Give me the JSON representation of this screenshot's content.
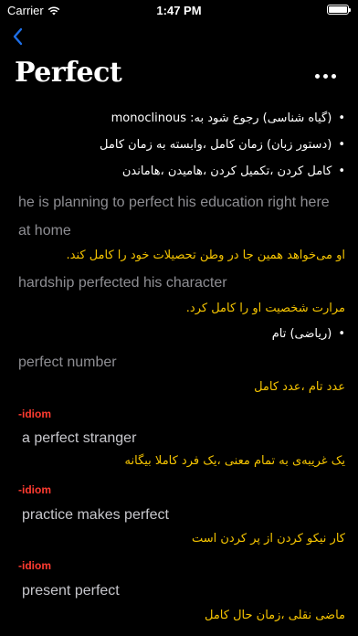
{
  "status_bar": {
    "carrier": "Carrier",
    "time": "1:47 PM"
  },
  "nav": {
    "back_icon": "chevron-left-icon",
    "title": "Perfect",
    "more_icon": "ellipsis-icon",
    "accent_color": "#1e6fe8"
  },
  "content": {
    "bullet_char": "•",
    "senses": [
      "(گیاه شناسی) رجوع شود به: monoclinous",
      "(دستور زبان) زمان کامل ،وابسته به زمان کامل",
      "کامل کردن ،تکمیل کردن ،هامیدن ،هاماندن"
    ],
    "example1": {
      "en_line1": "he is planning to perfect his education right here",
      "en_line2": "at home",
      "fa": "او می‌خواهد همین جا در وطن تحصیلات خود را کامل کند."
    },
    "example2": {
      "en": "hardship perfected his character",
      "fa": "مرارت شخصیت او را کامل کرد."
    },
    "sense4": "(ریاضی) تام",
    "example3": {
      "en": "perfect number",
      "fa": "عدد تام ،عدد کامل"
    },
    "idiom_label": "-idiom",
    "idioms": [
      {
        "phrase": "a perfect stranger",
        "fa": "یک غریبه‌ی به تمام معنی ،یک فرد کاملا بیگانه"
      },
      {
        "phrase": "practice makes perfect",
        "fa": "کار نیکو کردن از پر کردن است"
      },
      {
        "phrase": "present perfect",
        "fa": "ماضی نقلی ،زمان حال کامل"
      }
    ],
    "colors": {
      "background": "#000000",
      "text": "#ffffff",
      "example_en": "#8e8e93",
      "translation": "#f5c400",
      "idiom_label": "#ff3b30"
    }
  }
}
